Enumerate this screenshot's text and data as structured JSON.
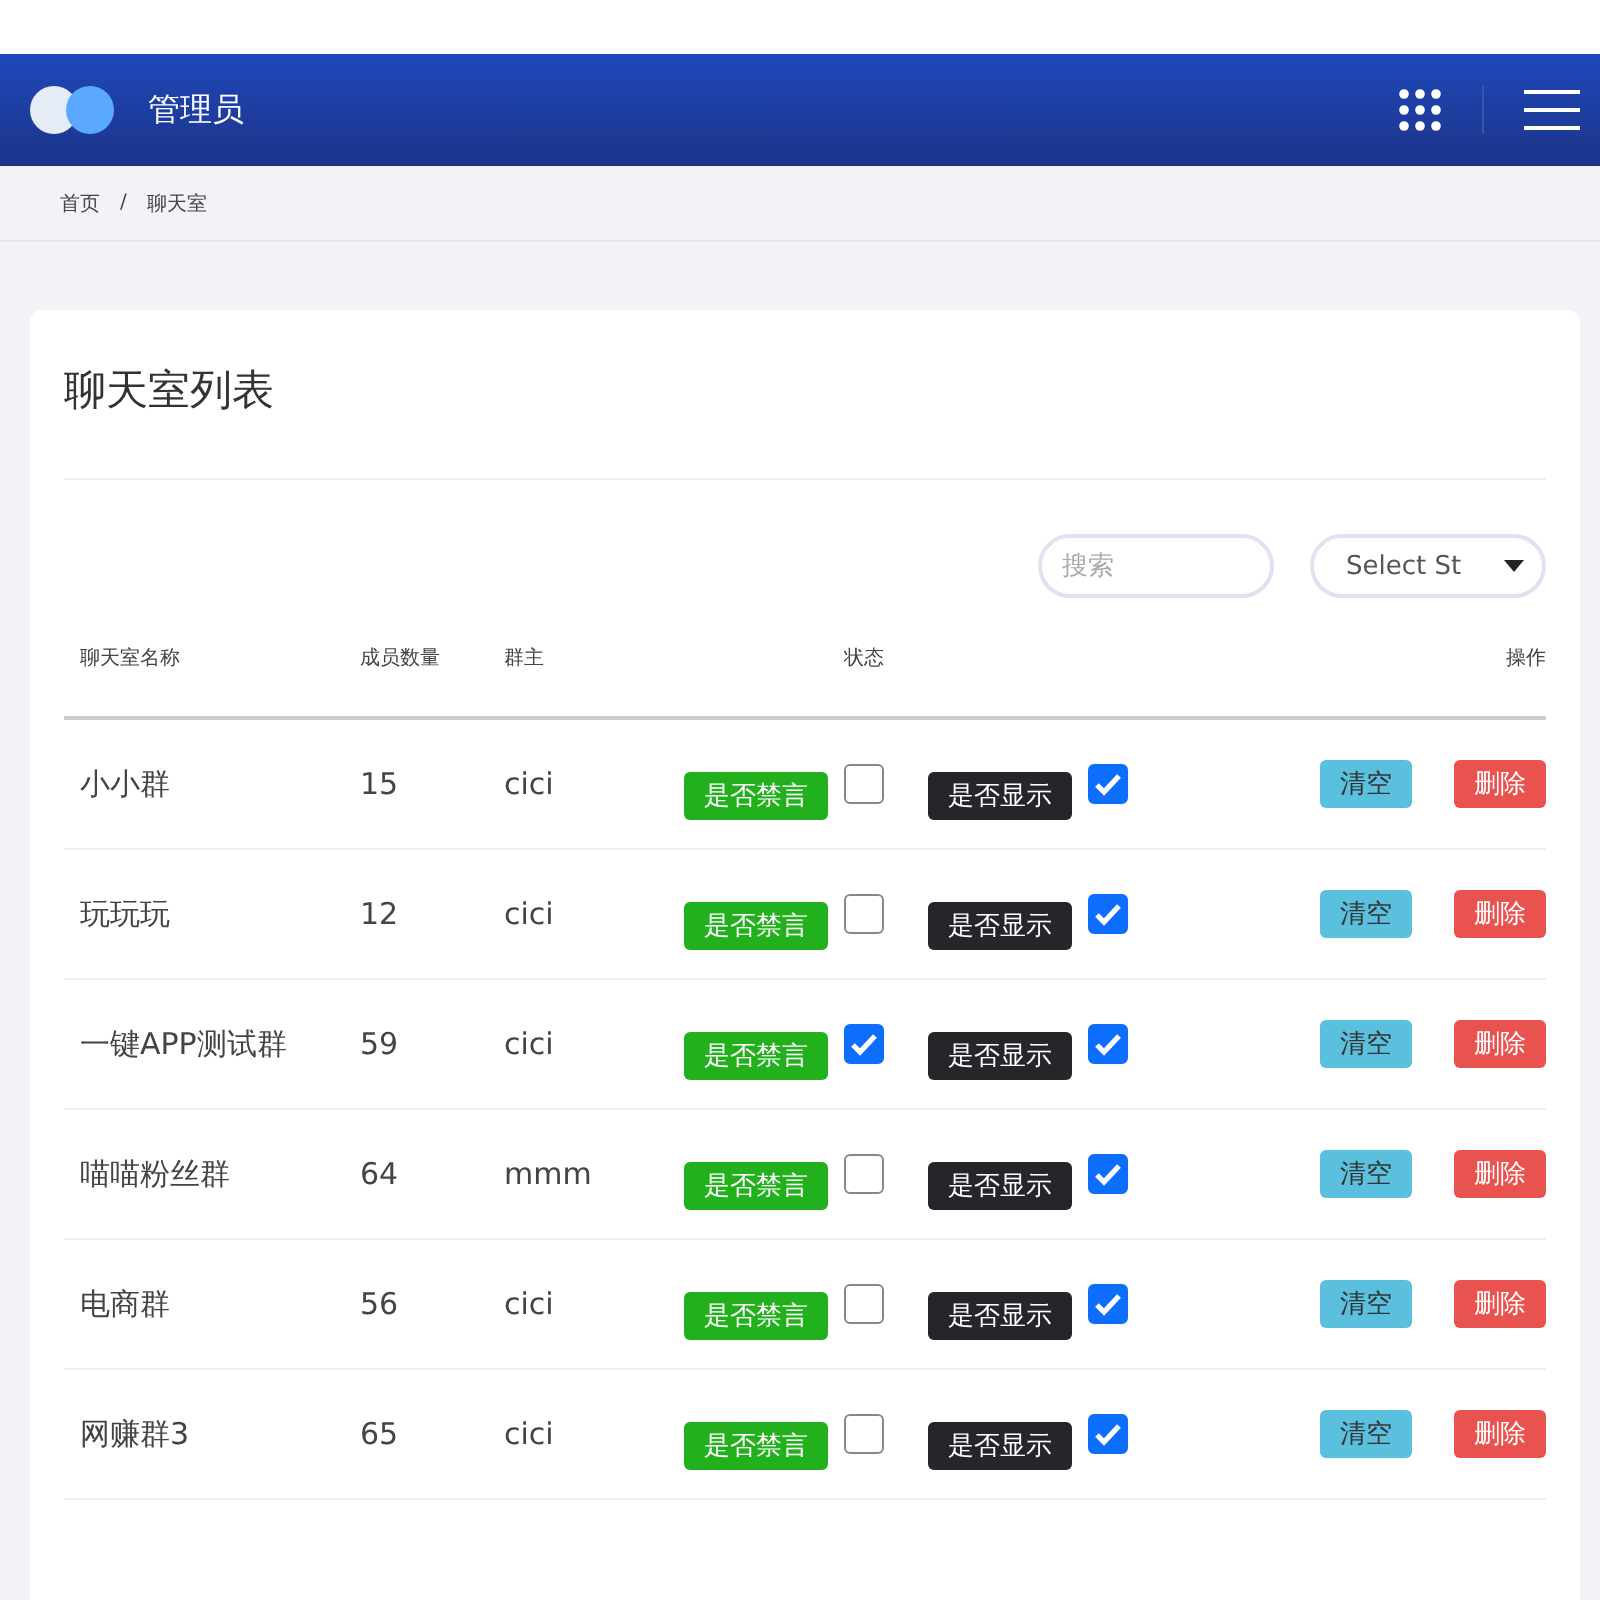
{
  "header": {
    "title": "管理员"
  },
  "breadcrumb": [
    "首页",
    "/",
    "聊天室"
  ],
  "card": {
    "title": "聊天室列表"
  },
  "search": {
    "placeholder": "搜索"
  },
  "select": {
    "value": "Select St"
  },
  "table": {
    "columns": [
      "聊天室名称",
      "成员数量",
      "群主",
      "状态",
      "操作"
    ],
    "rows": [
      {
        "name": "小小群",
        "members": "15",
        "owner": "cici",
        "mute_label": "是否禁言",
        "muted": false,
        "show_label": "是否显示",
        "shown": true,
        "clear": "清空",
        "delete": "删除"
      },
      {
        "name": "玩玩玩",
        "members": "12",
        "owner": "cici",
        "mute_label": "是否禁言",
        "muted": false,
        "show_label": "是否显示",
        "shown": true,
        "clear": "清空",
        "delete": "删除"
      },
      {
        "name": "一键APP测试群",
        "members": "59",
        "owner": "cici",
        "mute_label": "是否禁言",
        "muted": true,
        "show_label": "是否显示",
        "shown": true,
        "clear": "清空",
        "delete": "删除"
      },
      {
        "name": "喵喵粉丝群",
        "members": "64",
        "owner": "mmm",
        "mute_label": "是否禁言",
        "muted": false,
        "show_label": "是否显示",
        "shown": true,
        "clear": "清空",
        "delete": "删除"
      },
      {
        "name": "电商群",
        "members": "56",
        "owner": "cici",
        "mute_label": "是否禁言",
        "muted": false,
        "show_label": "是否显示",
        "shown": true,
        "clear": "清空",
        "delete": "删除"
      },
      {
        "name": "网赚群3",
        "members": "65",
        "owner": "cici",
        "mute_label": "是否禁言",
        "muted": false,
        "show_label": "是否显示",
        "shown": true,
        "clear": "清空",
        "delete": "删除"
      }
    ]
  }
}
